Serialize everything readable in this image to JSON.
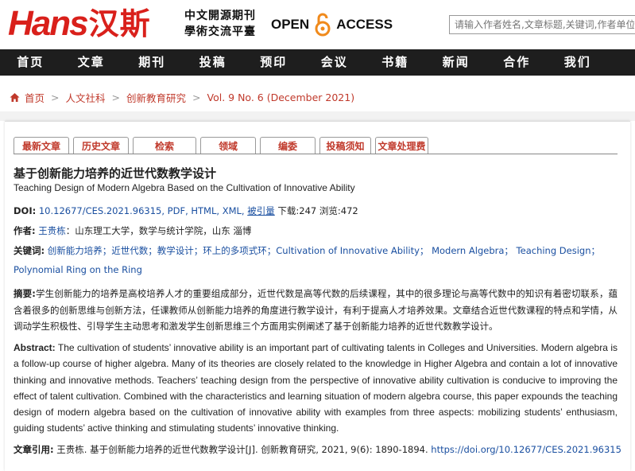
{
  "header": {
    "logo_latin": "Hans",
    "logo_cjk": "汉斯",
    "tagline_line1": "中文開源期刊",
    "tagline_line2": "學術交流平臺",
    "oa_left": "OPEN",
    "oa_right": "ACCESS",
    "search_placeholder": "请输入作者姓名,文章标题,关键词,作者单位"
  },
  "nav": [
    "首页",
    "文章",
    "期刊",
    "投稿",
    "预印",
    "会议",
    "书籍",
    "新闻",
    "合作",
    "我们"
  ],
  "breadcrumb": [
    "首页",
    "人文社科",
    "创新教育研究",
    "Vol. 9 No. 6 (December 2021)"
  ],
  "tabs": [
    "最新文章",
    "历史文章",
    "检索",
    "领域",
    "编委",
    "投稿须知",
    "文章处理费"
  ],
  "article": {
    "title_cn": "基于创新能力培养的近世代数教学设计",
    "title_en": "Teaching Design of Modern Algebra Based on the Cultivation of Innovative Ability",
    "doi_label": "DOI:",
    "doi_value": "10.12677/CES.2021.96315, PDF, HTML, XML,",
    "cited_by": "被引量",
    "downloads": "下载:247",
    "views": "浏览:472",
    "author_label": "作者:",
    "author_name": "王贵栋",
    "author_affil": "：山东理工大学，数学与统计学院，山东 淄博",
    "keywords_label": "关键词:",
    "keywords_line1": "创新能力培养；近世代数；教学设计；环上的多项式环；Cultivation of Innovative Ability； Modern Algebra； Teaching Design；",
    "keywords_line2": "Polynomial Ring on the Ring",
    "abstract_cn_label": "摘要:",
    "abstract_cn": "学生创新能力的培养是高校培养人才的重要组成部分，近世代数是高等代数的后续课程，其中的很多理论与高等代数中的知识有着密切联系，蕴含着很多的创新思维与创新方法，任课教师从创新能力培养的角度进行教学设计，有利于提高人才培养效果。文章结合近世代数课程的特点和学情，从调动学生积极性、引导学生主动思考和激发学生创新思维三个方面用实例阐述了基于创新能力培养的近世代数教学设计。",
    "abstract_en_label": "Abstract:",
    "abstract_en": "The cultivation of students’ innovative ability is an important part of cultivating talents in Colleges and Universities. Modern algebra is a follow-up course of higher algebra. Many of its theories are closely related to the knowledge in Higher Algebra and contain a lot of innovative thinking and innovative methods. Teachers’ teaching design from the perspective of innovative ability cultivation is conducive to improving the effect of talent cultivation. Combined with the characteristics and learning situation of modern algebra course, this paper expounds the teaching design of modern algebra based on the cultivation of innovative ability with examples from three aspects: mobilizing students’ enthusiasm, guiding students’ active thinking and stimulating students’ innovative thinking.",
    "citation_label": "文章引用:",
    "citation_text": "王贵栋. 基于创新能力培养的近世代数教学设计[J]. 创新教育研究, 2021, 9(6): 1890-1894.",
    "citation_link": "https://doi.org/10.12677/CES.2021.96315"
  },
  "colors": {
    "brand_red": "#d9201b",
    "nav_bg": "#1e1e1e",
    "link_blue": "#1a4fa0",
    "tab_red": "#c0392b"
  },
  "icons": {
    "home": "home-icon",
    "lock": "open-lock-icon"
  }
}
